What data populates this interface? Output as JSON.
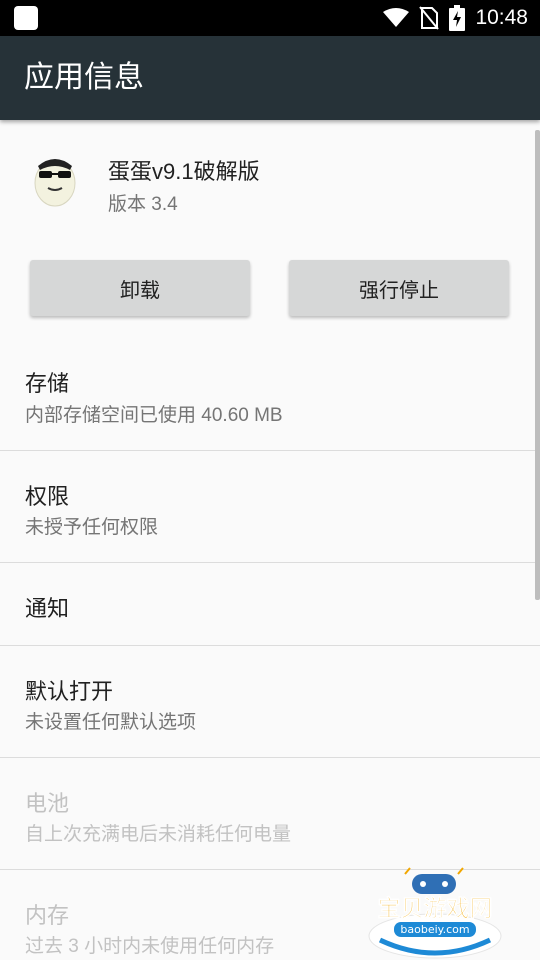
{
  "status_bar": {
    "time": "10:48",
    "icons": [
      "app-square-icon",
      "wifi-icon",
      "no-sim-icon",
      "battery-charging-icon"
    ]
  },
  "app_bar": {
    "title": "应用信息"
  },
  "app": {
    "name": "蛋蛋v9.1破解版",
    "version": "版本 3.4",
    "icon": "egg-sunglasses-app-icon"
  },
  "buttons": {
    "uninstall": "卸载",
    "force_stop": "强行停止"
  },
  "sections": [
    {
      "title": "存储",
      "subtitle": "内部存储空间已使用 40.60 MB",
      "enabled": true
    },
    {
      "title": "权限",
      "subtitle": "未授予任何权限",
      "enabled": true
    },
    {
      "title": "通知",
      "subtitle": "",
      "enabled": true
    },
    {
      "title": "默认打开",
      "subtitle": "未设置任何默认选项",
      "enabled": true
    },
    {
      "title": "电池",
      "subtitle": "自上次充满电后未消耗任何电量",
      "enabled": false
    },
    {
      "title": "内存",
      "subtitle": "过去 3 小时内未使用任何内存",
      "enabled": false
    }
  ],
  "watermark": {
    "name": "宝贝游戏网",
    "url": "baobeiy.com"
  },
  "colors": {
    "status_bar": "#000000",
    "app_bar": "#263238",
    "button": "#d6d7d7",
    "disabled_text": "#c2c2c2",
    "watermark_text": "#f2a700"
  }
}
